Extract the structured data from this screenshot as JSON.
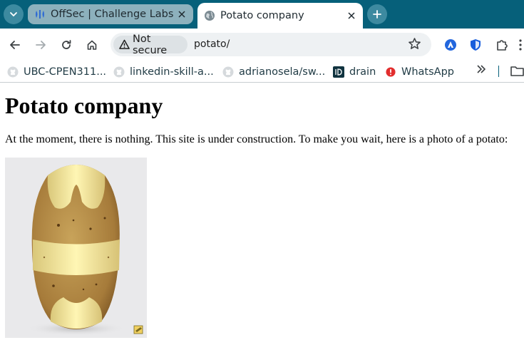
{
  "tabs": [
    {
      "title": "OffSec | Challenge Labs",
      "active": false,
      "favicon": "offsec-icon"
    },
    {
      "title": "Potato company",
      "active": true,
      "favicon": "globe-icon"
    }
  ],
  "toolbar": {
    "security_label": "Not secure",
    "url": "potato/"
  },
  "bookmarks": [
    {
      "label": "UBC-CPEN311...",
      "icon": "github-icon"
    },
    {
      "label": "linkedin-skill-a...",
      "icon": "github-icon"
    },
    {
      "label": "adrianosela/sw...",
      "icon": "github-icon"
    },
    {
      "label": "drain",
      "icon": "drain-icon"
    },
    {
      "label": "WhatsApp",
      "icon": "whatsapp-icon"
    }
  ],
  "page": {
    "heading": "Potato company",
    "intro": "At the moment, there is nothing. This site is under construction. To make you wait, here is a photo of a potato:"
  },
  "colors": {
    "tabstrip": "#06607a",
    "inactive_tab": "#8db1bd",
    "omnibox": "#eef1f3"
  }
}
